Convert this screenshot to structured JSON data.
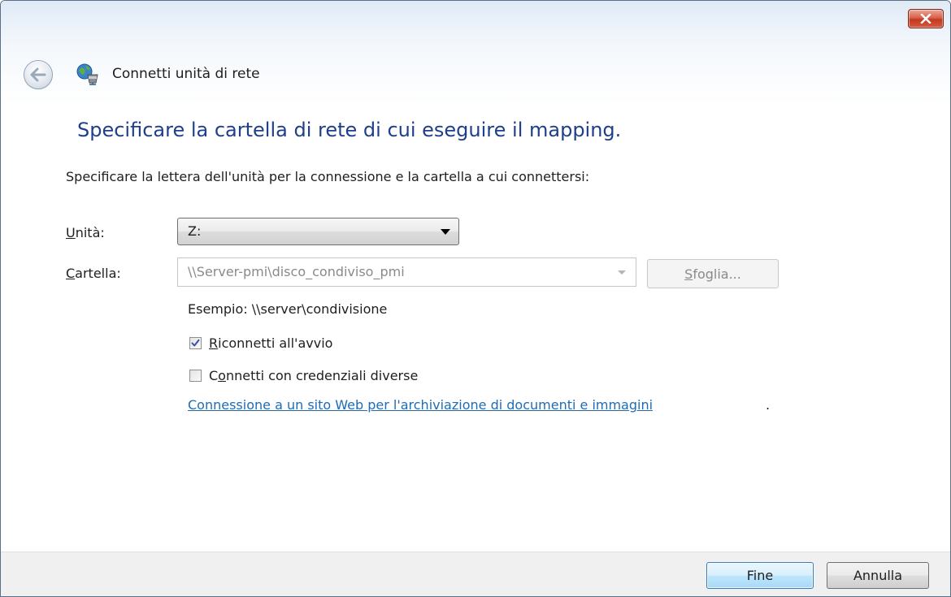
{
  "window": {
    "title": "Connetti unità di rete",
    "close_label": "×"
  },
  "header": {
    "heading": "Specificare la cartella di rete di cui eseguire il mapping.",
    "instruction": "Specificare la lettera dell'unità per la connessione e la cartella a cui connettersi:"
  },
  "form": {
    "drive_label_key": "U",
    "drive_label_rest": "nità:",
    "drive_value": "Z:",
    "folder_label_key": "C",
    "folder_label_rest": "artella:",
    "folder_value": "\\\\Server-pmi\\disco_condiviso_pmi",
    "browse_key": "S",
    "browse_rest": "foglia...",
    "example": "Esempio: \\\\server\\condivisione",
    "reconnect_key": "R",
    "reconnect_rest": "iconnetti all'avvio",
    "reconnect_checked": true,
    "credentials_pre": "C",
    "credentials_key": "o",
    "credentials_rest": "nnetti con credenziali diverse",
    "credentials_checked": false,
    "link_text": "Connessione a un sito Web per l'archiviazione di documenti e immagini",
    "link_suffix": "."
  },
  "footer": {
    "finish_label": "Fine",
    "cancel_label": "Annulla"
  },
  "colors": {
    "heading": "#1e3f8a",
    "link": "#1f6cb5",
    "close_button": "#c1391f"
  },
  "icons": {
    "back": "back-arrow-icon",
    "app": "network-drive-icon",
    "close": "close-icon",
    "check": "checkmark-icon",
    "dropdown": "chevron-down-icon"
  }
}
